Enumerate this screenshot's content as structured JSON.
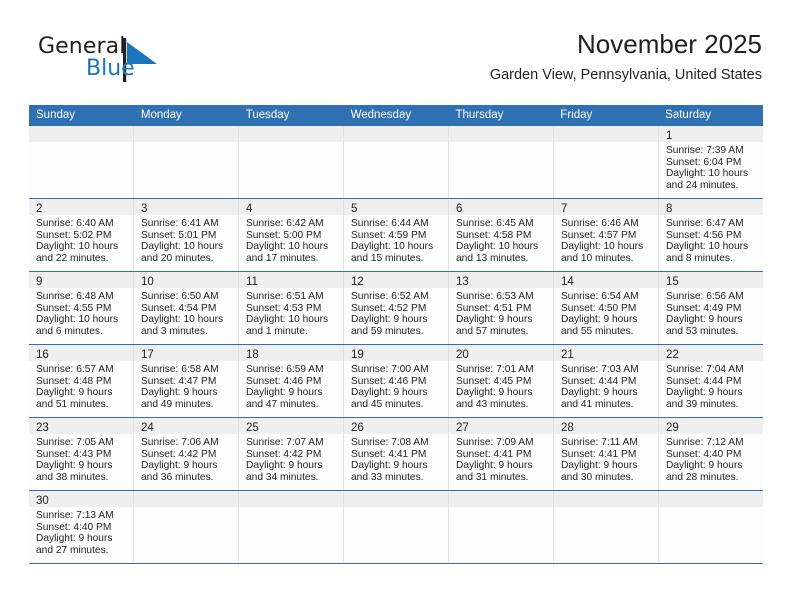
{
  "brand": {
    "name_part1": "General",
    "name_part2": "Blue",
    "logo_icon": "blue-flag-triangle"
  },
  "header": {
    "title": "November 2025",
    "subtitle": "Garden View, Pennsylvania, United States"
  },
  "colors": {
    "header_blue": "#2E70B2",
    "brand_blue": "#1B75BB",
    "daynum_band": "#efefef",
    "cell_bg": "#fdfdfd",
    "text": "#231f20"
  },
  "weekdays": [
    "Sunday",
    "Monday",
    "Tuesday",
    "Wednesday",
    "Thursday",
    "Friday",
    "Saturday"
  ],
  "weeks": [
    [
      {
        "blank": true
      },
      {
        "blank": true
      },
      {
        "blank": true
      },
      {
        "blank": true
      },
      {
        "blank": true
      },
      {
        "blank": true
      },
      {
        "day": "1",
        "sunrise": "Sunrise: 7:39 AM",
        "sunset": "Sunset: 6:04 PM",
        "daylight1": "Daylight: 10 hours",
        "daylight2": "and 24 minutes."
      }
    ],
    [
      {
        "day": "2",
        "sunrise": "Sunrise: 6:40 AM",
        "sunset": "Sunset: 5:02 PM",
        "daylight1": "Daylight: 10 hours",
        "daylight2": "and 22 minutes."
      },
      {
        "day": "3",
        "sunrise": "Sunrise: 6:41 AM",
        "sunset": "Sunset: 5:01 PM",
        "daylight1": "Daylight: 10 hours",
        "daylight2": "and 20 minutes."
      },
      {
        "day": "4",
        "sunrise": "Sunrise: 6:42 AM",
        "sunset": "Sunset: 5:00 PM",
        "daylight1": "Daylight: 10 hours",
        "daylight2": "and 17 minutes."
      },
      {
        "day": "5",
        "sunrise": "Sunrise: 6:44 AM",
        "sunset": "Sunset: 4:59 PM",
        "daylight1": "Daylight: 10 hours",
        "daylight2": "and 15 minutes."
      },
      {
        "day": "6",
        "sunrise": "Sunrise: 6:45 AM",
        "sunset": "Sunset: 4:58 PM",
        "daylight1": "Daylight: 10 hours",
        "daylight2": "and 13 minutes."
      },
      {
        "day": "7",
        "sunrise": "Sunrise: 6:46 AM",
        "sunset": "Sunset: 4:57 PM",
        "daylight1": "Daylight: 10 hours",
        "daylight2": "and 10 minutes."
      },
      {
        "day": "8",
        "sunrise": "Sunrise: 6:47 AM",
        "sunset": "Sunset: 4:56 PM",
        "daylight1": "Daylight: 10 hours",
        "daylight2": "and 8 minutes."
      }
    ],
    [
      {
        "day": "9",
        "sunrise": "Sunrise: 6:48 AM",
        "sunset": "Sunset: 4:55 PM",
        "daylight1": "Daylight: 10 hours",
        "daylight2": "and 6 minutes."
      },
      {
        "day": "10",
        "sunrise": "Sunrise: 6:50 AM",
        "sunset": "Sunset: 4:54 PM",
        "daylight1": "Daylight: 10 hours",
        "daylight2": "and 3 minutes."
      },
      {
        "day": "11",
        "sunrise": "Sunrise: 6:51 AM",
        "sunset": "Sunset: 4:53 PM",
        "daylight1": "Daylight: 10 hours",
        "daylight2": "and 1 minute."
      },
      {
        "day": "12",
        "sunrise": "Sunrise: 6:52 AM",
        "sunset": "Sunset: 4:52 PM",
        "daylight1": "Daylight: 9 hours",
        "daylight2": "and 59 minutes."
      },
      {
        "day": "13",
        "sunrise": "Sunrise: 6:53 AM",
        "sunset": "Sunset: 4:51 PM",
        "daylight1": "Daylight: 9 hours",
        "daylight2": "and 57 minutes."
      },
      {
        "day": "14",
        "sunrise": "Sunrise: 6:54 AM",
        "sunset": "Sunset: 4:50 PM",
        "daylight1": "Daylight: 9 hours",
        "daylight2": "and 55 minutes."
      },
      {
        "day": "15",
        "sunrise": "Sunrise: 6:56 AM",
        "sunset": "Sunset: 4:49 PM",
        "daylight1": "Daylight: 9 hours",
        "daylight2": "and 53 minutes."
      }
    ],
    [
      {
        "day": "16",
        "sunrise": "Sunrise: 6:57 AM",
        "sunset": "Sunset: 4:48 PM",
        "daylight1": "Daylight: 9 hours",
        "daylight2": "and 51 minutes."
      },
      {
        "day": "17",
        "sunrise": "Sunrise: 6:58 AM",
        "sunset": "Sunset: 4:47 PM",
        "daylight1": "Daylight: 9 hours",
        "daylight2": "and 49 minutes."
      },
      {
        "day": "18",
        "sunrise": "Sunrise: 6:59 AM",
        "sunset": "Sunset: 4:46 PM",
        "daylight1": "Daylight: 9 hours",
        "daylight2": "and 47 minutes."
      },
      {
        "day": "19",
        "sunrise": "Sunrise: 7:00 AM",
        "sunset": "Sunset: 4:46 PM",
        "daylight1": "Daylight: 9 hours",
        "daylight2": "and 45 minutes."
      },
      {
        "day": "20",
        "sunrise": "Sunrise: 7:01 AM",
        "sunset": "Sunset: 4:45 PM",
        "daylight1": "Daylight: 9 hours",
        "daylight2": "and 43 minutes."
      },
      {
        "day": "21",
        "sunrise": "Sunrise: 7:03 AM",
        "sunset": "Sunset: 4:44 PM",
        "daylight1": "Daylight: 9 hours",
        "daylight2": "and 41 minutes."
      },
      {
        "day": "22",
        "sunrise": "Sunrise: 7:04 AM",
        "sunset": "Sunset: 4:44 PM",
        "daylight1": "Daylight: 9 hours",
        "daylight2": "and 39 minutes."
      }
    ],
    [
      {
        "day": "23",
        "sunrise": "Sunrise: 7:05 AM",
        "sunset": "Sunset: 4:43 PM",
        "daylight1": "Daylight: 9 hours",
        "daylight2": "and 38 minutes."
      },
      {
        "day": "24",
        "sunrise": "Sunrise: 7:06 AM",
        "sunset": "Sunset: 4:42 PM",
        "daylight1": "Daylight: 9 hours",
        "daylight2": "and 36 minutes."
      },
      {
        "day": "25",
        "sunrise": "Sunrise: 7:07 AM",
        "sunset": "Sunset: 4:42 PM",
        "daylight1": "Daylight: 9 hours",
        "daylight2": "and 34 minutes."
      },
      {
        "day": "26",
        "sunrise": "Sunrise: 7:08 AM",
        "sunset": "Sunset: 4:41 PM",
        "daylight1": "Daylight: 9 hours",
        "daylight2": "and 33 minutes."
      },
      {
        "day": "27",
        "sunrise": "Sunrise: 7:09 AM",
        "sunset": "Sunset: 4:41 PM",
        "daylight1": "Daylight: 9 hours",
        "daylight2": "and 31 minutes."
      },
      {
        "day": "28",
        "sunrise": "Sunrise: 7:11 AM",
        "sunset": "Sunset: 4:41 PM",
        "daylight1": "Daylight: 9 hours",
        "daylight2": "and 30 minutes."
      },
      {
        "day": "29",
        "sunrise": "Sunrise: 7:12 AM",
        "sunset": "Sunset: 4:40 PM",
        "daylight1": "Daylight: 9 hours",
        "daylight2": "and 28 minutes."
      }
    ],
    [
      {
        "day": "30",
        "sunrise": "Sunrise: 7:13 AM",
        "sunset": "Sunset: 4:40 PM",
        "daylight1": "Daylight: 9 hours",
        "daylight2": "and 27 minutes."
      },
      {
        "empty": true
      },
      {
        "empty": true
      },
      {
        "empty": true
      },
      {
        "empty": true
      },
      {
        "empty": true
      },
      {
        "empty": true
      }
    ]
  ]
}
